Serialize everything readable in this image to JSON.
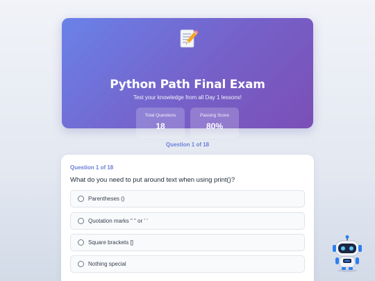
{
  "hero": {
    "icon": "memo-icon",
    "title": "Python Path Final Exam",
    "subtitle": "Test your knowledge from all Day 1 lessons!",
    "stats": [
      {
        "label": "Total Questions",
        "value": "18"
      },
      {
        "label": "Passing Score",
        "value": "80%"
      }
    ]
  },
  "progress": {
    "label": "Question 1 of 18"
  },
  "question": {
    "number_label": "Question 1 of 18",
    "text": "What do you need to put around text when using print()?",
    "options": [
      {
        "label": "Parentheses ()"
      },
      {
        "label": "Quotation marks \" \" or ' '"
      },
      {
        "label": "Square brackets []"
      },
      {
        "label": "Nothing special"
      }
    ]
  },
  "assistant": {
    "icon": "robot-icon"
  },
  "colors": {
    "accent": "#6a7fd8",
    "hero_start": "#6a82e8",
    "hero_end": "#7b4fb6"
  }
}
